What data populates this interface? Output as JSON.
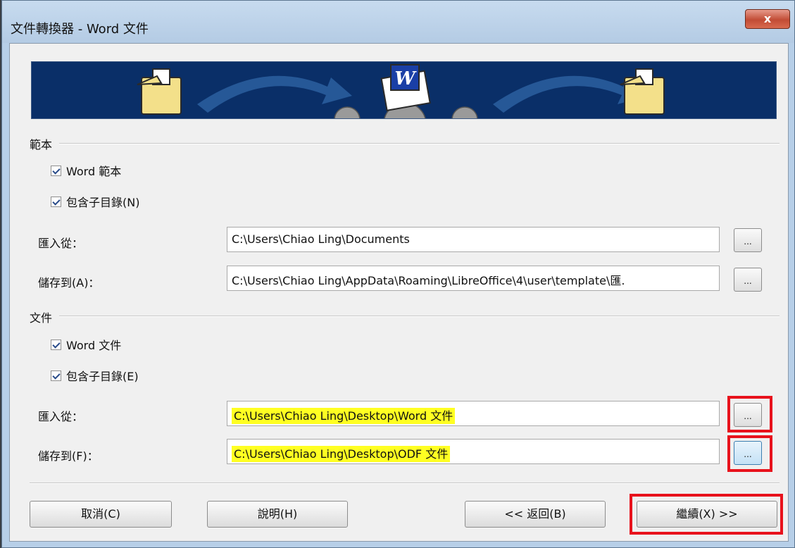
{
  "window": {
    "title": "文件轉換器 - Word 文件",
    "close_label": "x"
  },
  "templates": {
    "section_title": "範本",
    "word_checkbox": "Word 範本",
    "subdir_checkbox": "包含子目錄(N)",
    "import_label": "匯入從：",
    "import_value": "C:\\Users\\Chiao Ling\\Documents",
    "save_label": "儲存到(A)：",
    "save_value": "C:\\Users\\Chiao Ling\\AppData\\Roaming\\LibreOffice\\4\\user\\template\\匯."
  },
  "documents": {
    "section_title": "文件",
    "word_checkbox": "Word 文件",
    "subdir_checkbox": "包含子目錄(E)",
    "import_label": "匯入從：",
    "import_value": "C:\\Users\\Chiao Ling\\Desktop\\Word 文件",
    "save_label": "儲存到(F)：",
    "save_value": "C:\\Users\\Chiao Ling\\Desktop\\ODF 文件"
  },
  "browse_label": "...",
  "buttons": {
    "cancel": "取消(C)",
    "help": "說明(H)",
    "back": "<< 返回(B)",
    "next": "繼續(X) >>"
  },
  "colors": {
    "banner": "#0a2f68",
    "highlight": "#ffff22",
    "annotation": "#e8121c"
  }
}
